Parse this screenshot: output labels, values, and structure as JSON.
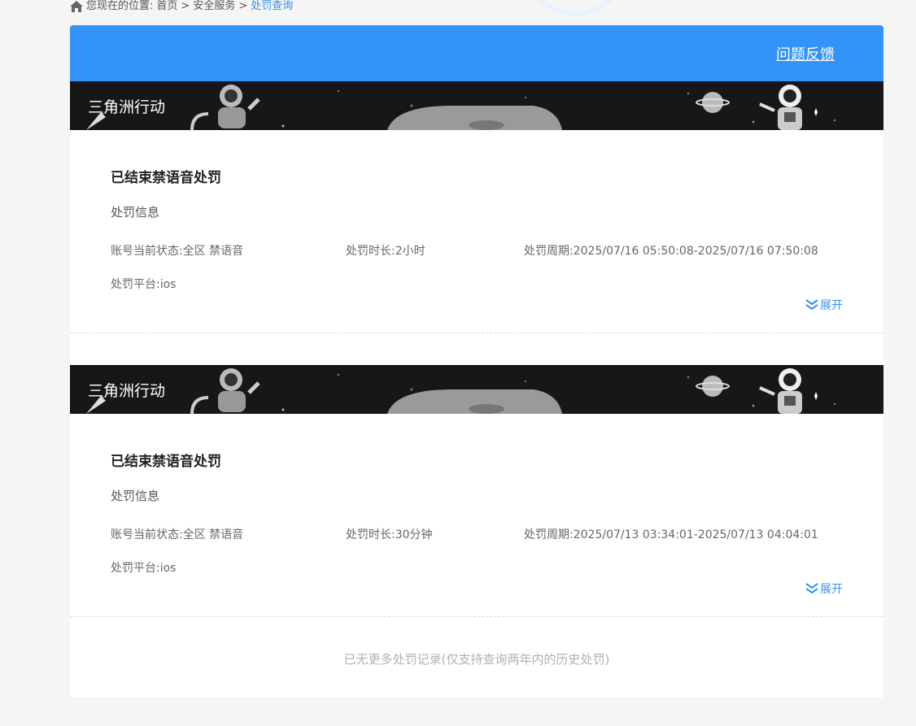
{
  "breadcrumb": {
    "prefix": "您现在的位置:",
    "home": "首页",
    "sep1": ">",
    "service": "安全服务",
    "sep2": ">",
    "current": "处罚查询"
  },
  "header": {
    "feedback": "问题反馈"
  },
  "records": [
    {
      "game": "三角洲行动",
      "title": "已结束禁语音处罚",
      "section": "处罚信息",
      "status_label": "账号当前状态:",
      "status_value": "全区 禁语音",
      "duration_label": "处罚时长:",
      "duration_value": "2小时",
      "period_label": "处罚周期:",
      "period_value": "2025/07/16 05:50:08-2025/07/16 07:50:08",
      "platform_label": "处罚平台:",
      "platform_value": "ios",
      "expand": "展开"
    },
    {
      "game": "三角洲行动",
      "title": "已结束禁语音处罚",
      "section": "处罚信息",
      "status_label": "账号当前状态:",
      "status_value": "全区 禁语音",
      "duration_label": "处罚时长:",
      "duration_value": "30分钟",
      "period_label": "处罚周期:",
      "period_value": "2025/07/13 03:34:01-2025/07/13 04:04:01",
      "platform_label": "处罚平台:",
      "platform_value": "ios",
      "expand": "展开"
    }
  ],
  "footer": {
    "no_more": "已无更多处罚记录(仅支持查询两年内的历史处罚)"
  },
  "colors": {
    "accent": "#3393f8",
    "banner": "#171717"
  }
}
